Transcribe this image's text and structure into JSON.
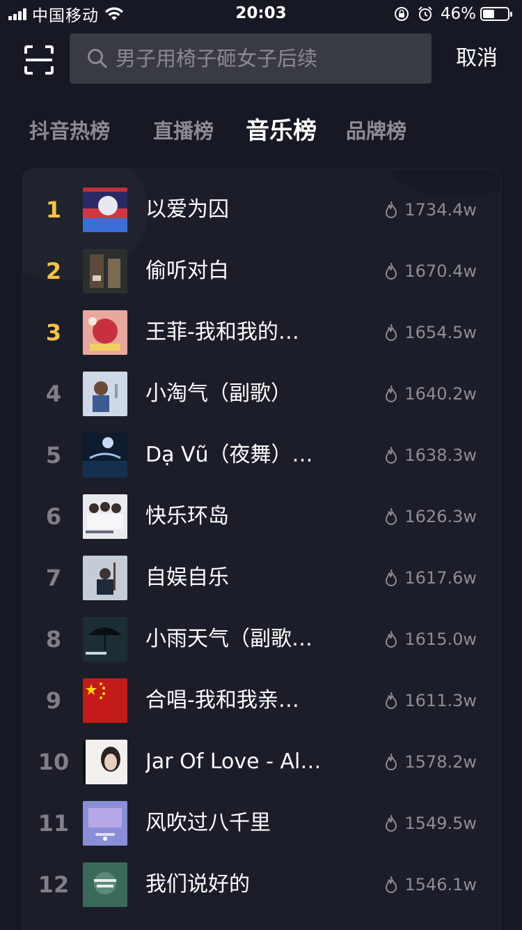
{
  "status_bar": {
    "carrier": "中国移动",
    "time": "20:03",
    "battery_percent": "46%",
    "battery_level": 0.46
  },
  "search": {
    "placeholder": "男子用椅子砸女子后续",
    "cancel_label": "取消"
  },
  "tabs": [
    {
      "label": "抖音热榜",
      "active": false
    },
    {
      "label": "直播榜",
      "active": false
    },
    {
      "label": "音乐榜",
      "active": true
    },
    {
      "label": "品牌榜",
      "active": false
    }
  ],
  "music_chart": [
    {
      "rank": "1",
      "title": "以爱为囚",
      "heat": "1734.4w"
    },
    {
      "rank": "2",
      "title": "偷听对白",
      "heat": "1670.4w"
    },
    {
      "rank": "3",
      "title": "王菲-我和我的…",
      "heat": "1654.5w"
    },
    {
      "rank": "4",
      "title": "小淘气（副歌）",
      "heat": "1640.2w"
    },
    {
      "rank": "5",
      "title": "Dạ Vũ（夜舞）…",
      "heat": "1638.3w"
    },
    {
      "rank": "6",
      "title": "快乐环岛",
      "heat": "1626.3w"
    },
    {
      "rank": "7",
      "title": "自娱自乐",
      "heat": "1617.6w"
    },
    {
      "rank": "8",
      "title": "小雨天气（副歌…",
      "heat": "1615.0w"
    },
    {
      "rank": "9",
      "title": "合唱-我和我亲…",
      "heat": "1611.3w"
    },
    {
      "rank": "10",
      "title": "Jar Of Love - Al…",
      "heat": "1578.2w"
    },
    {
      "rank": "11",
      "title": "风吹过八千里",
      "heat": "1549.5w"
    },
    {
      "rank": "12",
      "title": "我们说好的",
      "heat": "1546.1w"
    }
  ],
  "colors": {
    "background": "#161823",
    "top_rank": "#f5c243",
    "muted": "#8b8c92"
  }
}
